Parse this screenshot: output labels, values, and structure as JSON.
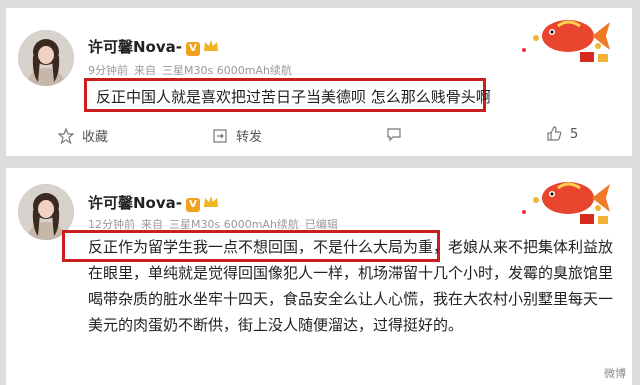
{
  "feed": {
    "posts": [
      {
        "username": "许可馨Nova-",
        "badge": "V",
        "time": "9分钟前",
        "source_prefix": "来自",
        "device": "三星M30s 6000mAh续航",
        "edited": "",
        "text": "反正中国人就是喜欢把过苦日子当美德呗 怎么那么贱骨头啊",
        "highlight": "反正中国人就是喜欢把过苦日子当美德呗 怎么那么贱骨头啊",
        "highlight_color": "#c81e1e",
        "actions": {
          "favorite": "收藏",
          "repost": "转发",
          "like_count": "5"
        }
      },
      {
        "username": "许可馨Nova-",
        "badge": "V",
        "time": "12分钟前",
        "source_prefix": "来自",
        "device": "三星M30s 6000mAh续航",
        "edited": "已编辑",
        "text_lines": [
          "反正作为留学生我一点不想回国，不是什么大局为重，老娘从来不把集体利益放",
          "在眼里，单纯就是觉得回国像犯人一样，机场滞留十几个小时，发霉的臭旅馆里",
          "喝带杂质的脏水坐牢十四天，食品安全么让人心慌，我在大农村小别墅里每天一",
          "美元的肉蛋奶不断供，街上没人随便溜达，过得挺好的。"
        ],
        "highlight": "反正作为留学生我一点不想回国，不是什么大局为重，",
        "highlight_color": "#c81e1e"
      }
    ]
  },
  "watermark": "微博",
  "icons": [
    "avatar",
    "verified-badge",
    "crown-icon",
    "fish-decoration-icon",
    "star-icon",
    "repost-icon",
    "comment-icon",
    "like-icon"
  ]
}
